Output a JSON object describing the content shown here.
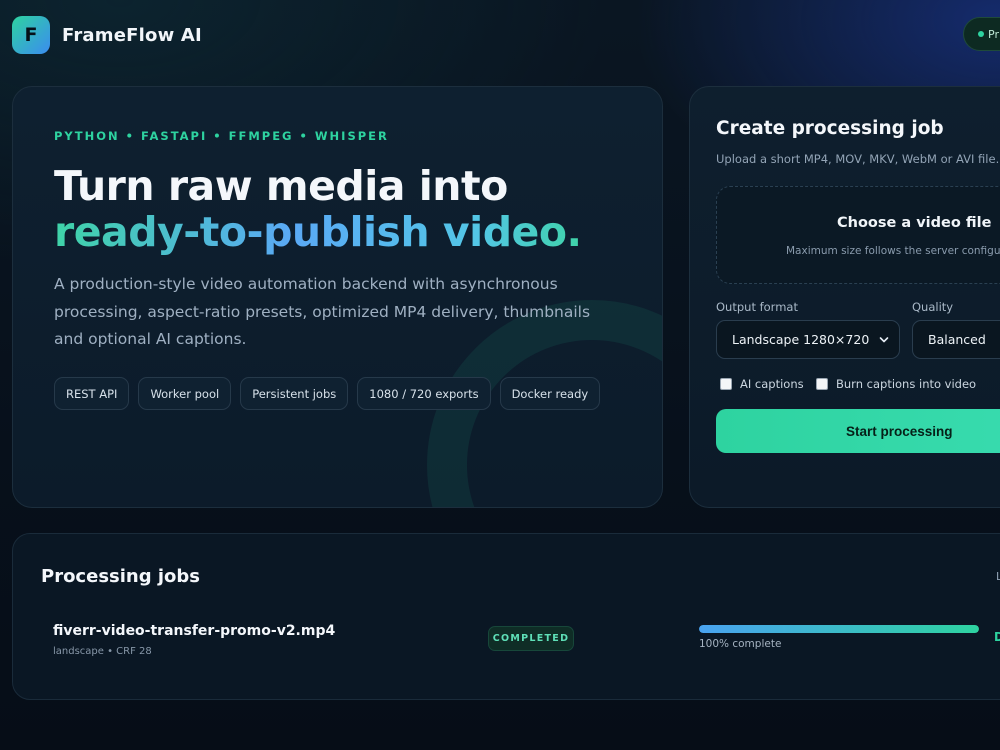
{
  "header": {
    "logo_letter": "F",
    "brand_name": "FrameFlow AI",
    "status_text": "Pr"
  },
  "hero": {
    "tech_stack": "PYTHON • FASTAPI • FFMPEG • WHISPER",
    "title_line1": "Turn raw media into",
    "title_line2_grad": "ready-to-publish video.",
    "description": "A production-style video automation backend with asynchronous processing, aspect-ratio presets, optimized MP4 delivery, thumbnails and optional AI captions.",
    "chips": [
      "REST API",
      "Worker pool",
      "Persistent jobs",
      "1080 / 720 exports",
      "Docker ready"
    ]
  },
  "create_job": {
    "title": "Create processing job",
    "subtitle": "Upload a short MP4, MOV, MKV, WebM or AVI file.",
    "dropzone_title": "Choose a video file",
    "dropzone_subtitle": "Maximum size follows the server configu",
    "output_format_label": "Output format",
    "output_format_value": "Landscape 1280×720",
    "quality_label": "Quality",
    "quality_value": "Balanced",
    "ai_captions_label": "AI captions",
    "burn_captions_label": "Burn captions into video",
    "start_button": "Start processing"
  },
  "jobs": {
    "title": "Processing jobs",
    "more_link": "L",
    "items": [
      {
        "name": "fiverr-video-transfer-promo-v2.mp4",
        "meta": "landscape • CRF 28",
        "status": "COMPLETED",
        "progress": 100,
        "progress_text": "100% complete",
        "action": "D"
      }
    ]
  },
  "colors": {
    "accent": "#2ed3a0",
    "accent_blue": "#4aa3f0",
    "background": "#07101b"
  }
}
